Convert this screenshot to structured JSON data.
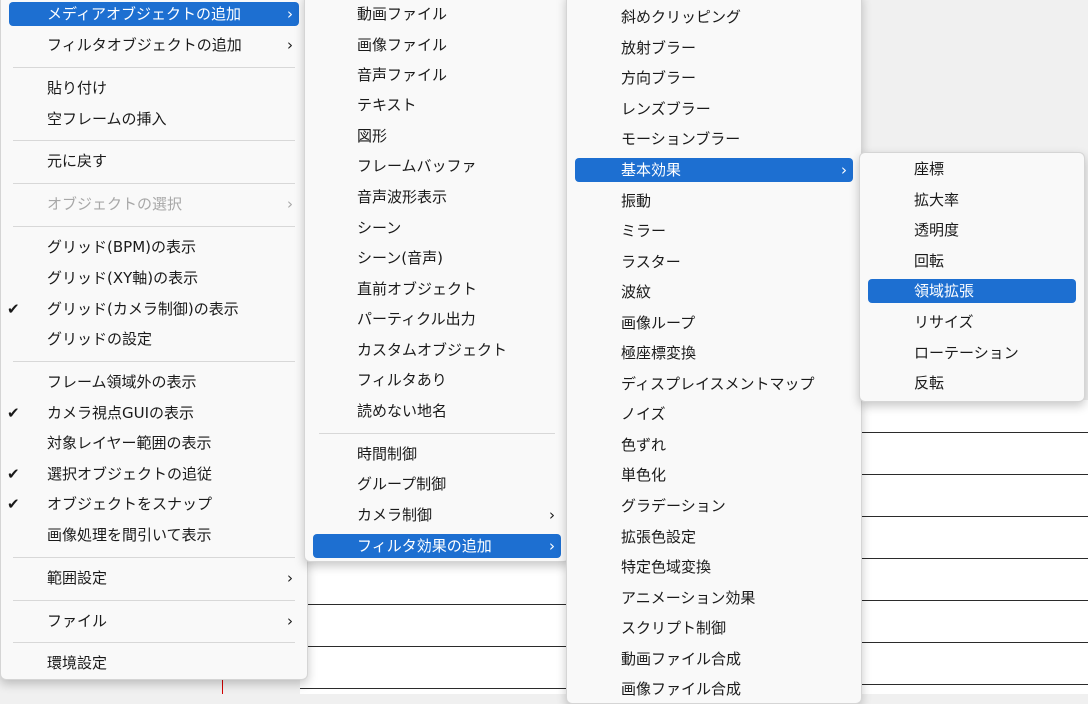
{
  "menu1": {
    "items": [
      {
        "label": "メディアオブジェクトの追加",
        "submenu": true,
        "selected": true
      },
      {
        "label": "フィルタオブジェクトの追加",
        "submenu": true
      },
      {
        "label": "貼り付け"
      },
      {
        "label": "空フレームの挿入"
      },
      {
        "label": "元に戻す"
      },
      {
        "label": "オブジェクトの選択",
        "submenu": true,
        "disabled": true
      },
      {
        "label": "グリッド(BPM)の表示"
      },
      {
        "label": "グリッド(XY軸)の表示"
      },
      {
        "label": "グリッド(カメラ制御)の表示",
        "checked": true
      },
      {
        "label": "グリッドの設定"
      },
      {
        "label": "フレーム領域外の表示"
      },
      {
        "label": "カメラ視点GUIの表示",
        "checked": true
      },
      {
        "label": "対象レイヤー範囲の表示"
      },
      {
        "label": "選択オブジェクトの追従",
        "checked": true
      },
      {
        "label": "オブジェクトをスナップ",
        "checked": true
      },
      {
        "label": "画像処理を間引いて表示"
      },
      {
        "label": "範囲設定",
        "submenu": true
      },
      {
        "label": "ファイル",
        "submenu": true
      },
      {
        "label": "環境設定"
      }
    ]
  },
  "menu2": {
    "items": [
      {
        "label": "動画ファイル"
      },
      {
        "label": "画像ファイル"
      },
      {
        "label": "音声ファイル"
      },
      {
        "label": "テキスト"
      },
      {
        "label": "図形"
      },
      {
        "label": "フレームバッファ"
      },
      {
        "label": "音声波形表示"
      },
      {
        "label": "シーン"
      },
      {
        "label": "シーン(音声)"
      },
      {
        "label": "直前オブジェクト"
      },
      {
        "label": "パーティクル出力"
      },
      {
        "label": "カスタムオブジェクト"
      },
      {
        "label": "フィルタあり"
      },
      {
        "label": "読めない地名"
      },
      {
        "label": "時間制御"
      },
      {
        "label": "グループ制御"
      },
      {
        "label": "カメラ制御",
        "submenu": true
      },
      {
        "label": "フィルタ効果の追加",
        "submenu": true,
        "selected": true
      }
    ]
  },
  "menu3": {
    "items": [
      {
        "label": "斜めクリッピング"
      },
      {
        "label": "放射ブラー"
      },
      {
        "label": "方向ブラー"
      },
      {
        "label": "レンズブラー"
      },
      {
        "label": "モーションブラー"
      },
      {
        "label": "基本効果",
        "submenu": true,
        "selected": true
      },
      {
        "label": "振動"
      },
      {
        "label": "ミラー"
      },
      {
        "label": "ラスター"
      },
      {
        "label": "波紋"
      },
      {
        "label": "画像ループ"
      },
      {
        "label": "極座標変換"
      },
      {
        "label": "ディスプレイスメントマップ"
      },
      {
        "label": "ノイズ"
      },
      {
        "label": "色ずれ"
      },
      {
        "label": "単色化"
      },
      {
        "label": "グラデーション"
      },
      {
        "label": "拡張色設定"
      },
      {
        "label": "特定色域変換"
      },
      {
        "label": "アニメーション効果"
      },
      {
        "label": "スクリプト制御"
      },
      {
        "label": "動画ファイル合成"
      },
      {
        "label": "画像ファイル合成"
      }
    ]
  },
  "menu4": {
    "items": [
      {
        "label": "座標"
      },
      {
        "label": "拡大率"
      },
      {
        "label": "透明度"
      },
      {
        "label": "回転"
      },
      {
        "label": "領域拡張",
        "selected": true
      },
      {
        "label": "リサイズ"
      },
      {
        "label": "ローテーション"
      },
      {
        "label": "反転"
      }
    ]
  },
  "glyphs": {
    "chevron": "›",
    "check": "✔"
  },
  "colors": {
    "highlight": "#1d6fd1",
    "disabled_text": "#a8a8a8",
    "menu_bg": "#f9f9f9"
  }
}
